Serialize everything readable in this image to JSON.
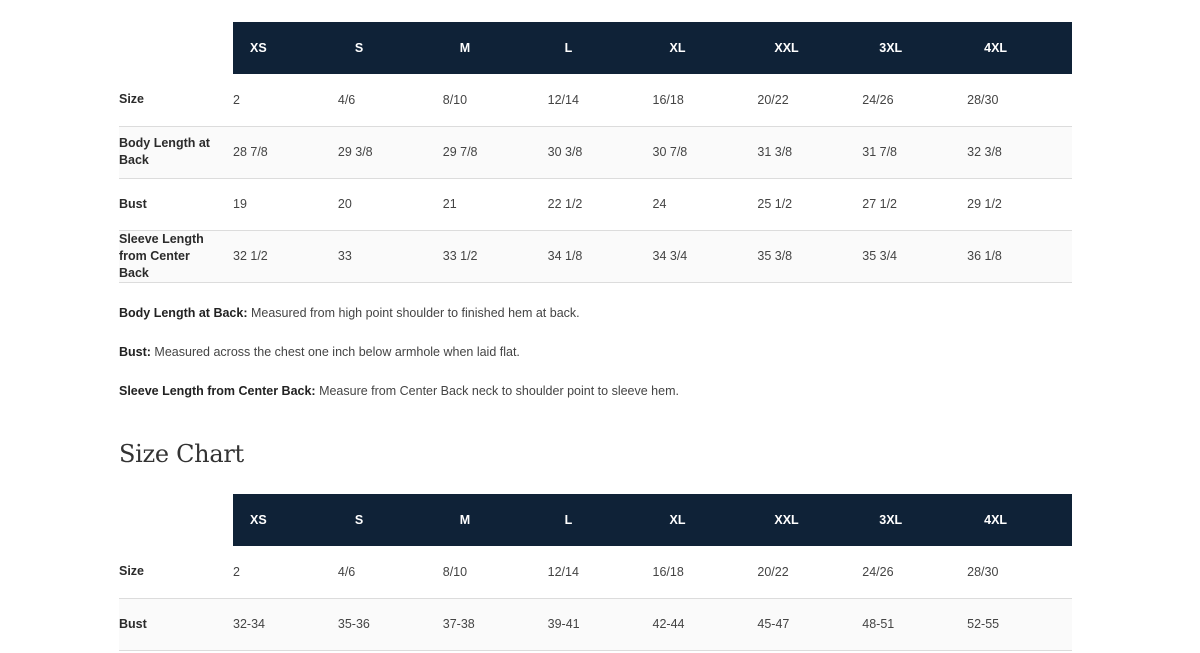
{
  "table1": {
    "headers": [
      "XS",
      "S",
      "M",
      "L",
      "XL",
      "XXL",
      "3XL",
      "4XL"
    ],
    "rows": [
      {
        "label": "Size",
        "values": [
          "2",
          "4/6",
          "8/10",
          "12/14",
          "16/18",
          "20/22",
          "24/26",
          "28/30"
        ]
      },
      {
        "label": "Body Length at Back",
        "values": [
          "28 7/8",
          "29 3/8",
          "29 7/8",
          "30 3/8",
          "30 7/8",
          "31 3/8",
          "31 7/8",
          "32 3/8"
        ]
      },
      {
        "label": "Bust",
        "values": [
          "19",
          "20",
          "21",
          "22 1/2",
          "24",
          "25 1/2",
          "27 1/2",
          "29 1/2"
        ]
      },
      {
        "label": "Sleeve Length from Center Back",
        "values": [
          "32 1/2",
          "33",
          "33 1/2",
          "34 1/8",
          "34 3/4",
          "35 3/8",
          "35 3/4",
          "36 1/8"
        ]
      }
    ]
  },
  "notes": [
    {
      "term": "Body Length at Back:",
      "text": " Measured from high point shoulder to finished hem at back."
    },
    {
      "term": "Bust:",
      "text": " Measured across the chest one inch below armhole when laid flat."
    },
    {
      "term": "Sleeve Length from Center Back:",
      "text": " Measure from Center Back neck to shoulder point to sleeve hem."
    }
  ],
  "section": {
    "title": "Size Chart"
  },
  "table2": {
    "headers": [
      "XS",
      "S",
      "M",
      "L",
      "XL",
      "XXL",
      "3XL",
      "4XL"
    ],
    "rows": [
      {
        "label": "Size",
        "values": [
          "2",
          "4/6",
          "8/10",
          "12/14",
          "16/18",
          "20/22",
          "24/26",
          "28/30"
        ]
      },
      {
        "label": "Bust",
        "values": [
          "32-34",
          "35-36",
          "37-38",
          "39-41",
          "42-44",
          "45-47",
          "48-51",
          "52-55"
        ]
      }
    ]
  },
  "colors": {
    "header_bg": "#0f2237",
    "header_text": "#ffffff",
    "row_divider": "#dcdcdc"
  }
}
